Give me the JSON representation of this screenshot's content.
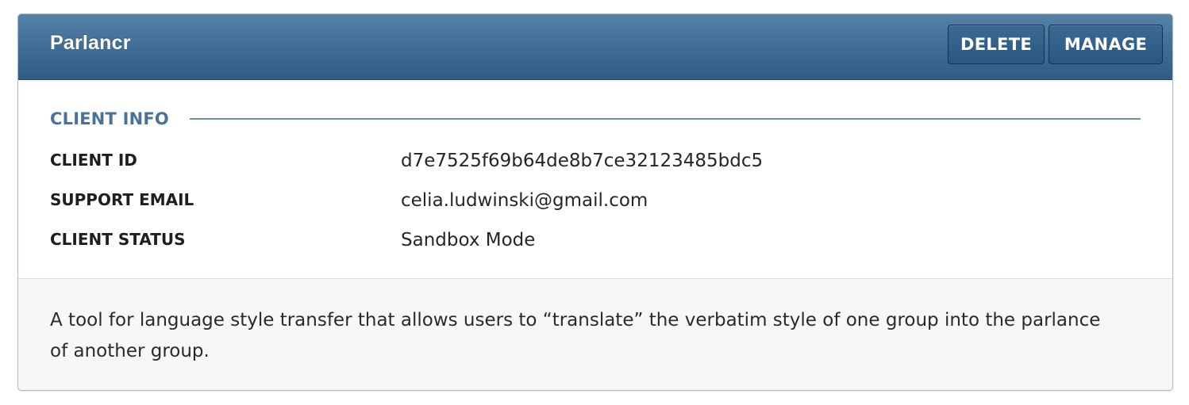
{
  "header": {
    "title": "Parlancr",
    "delete_label": "DELETE",
    "manage_label": "MANAGE"
  },
  "client_info": {
    "section_title": "CLIENT INFO",
    "fields": [
      {
        "label": "CLIENT ID",
        "value": "d7e7525f69b64de8b7ce32123485bdc5"
      },
      {
        "label": "SUPPORT EMAIL",
        "value": "celia.ludwinski@gmail.com"
      },
      {
        "label": "CLIENT STATUS",
        "value": "Sandbox Mode"
      }
    ]
  },
  "description": "A tool for language style transfer that allows users to “translate” the verbatim style of one group into the parlance of another group.",
  "colors": {
    "header_bg": "#3f6b94",
    "accent": "#4a7299",
    "footer_bg": "#f7f7f7"
  }
}
